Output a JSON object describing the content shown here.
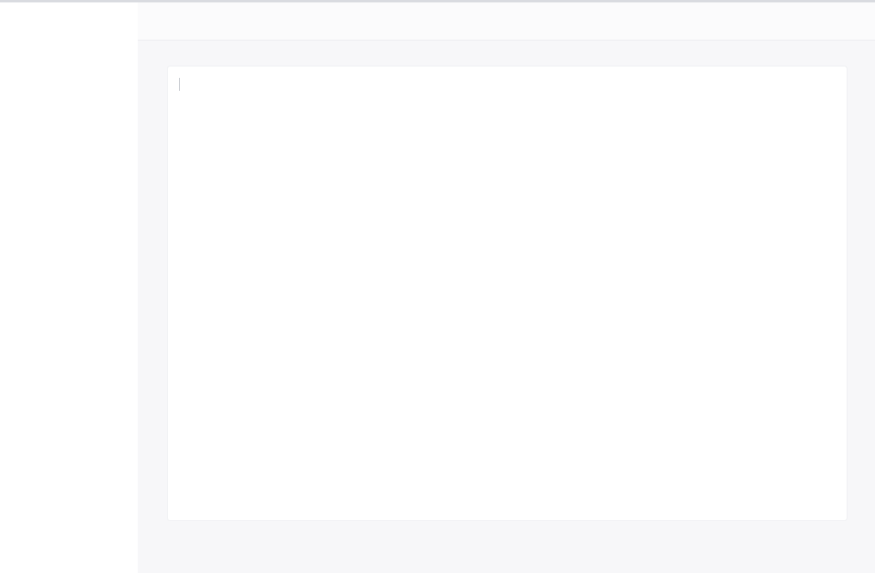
{
  "window": {
    "status_text": ""
  },
  "colors": {
    "background": "#ffffff",
    "panel": "#f7f7f9",
    "border": "#e6e7eb"
  }
}
